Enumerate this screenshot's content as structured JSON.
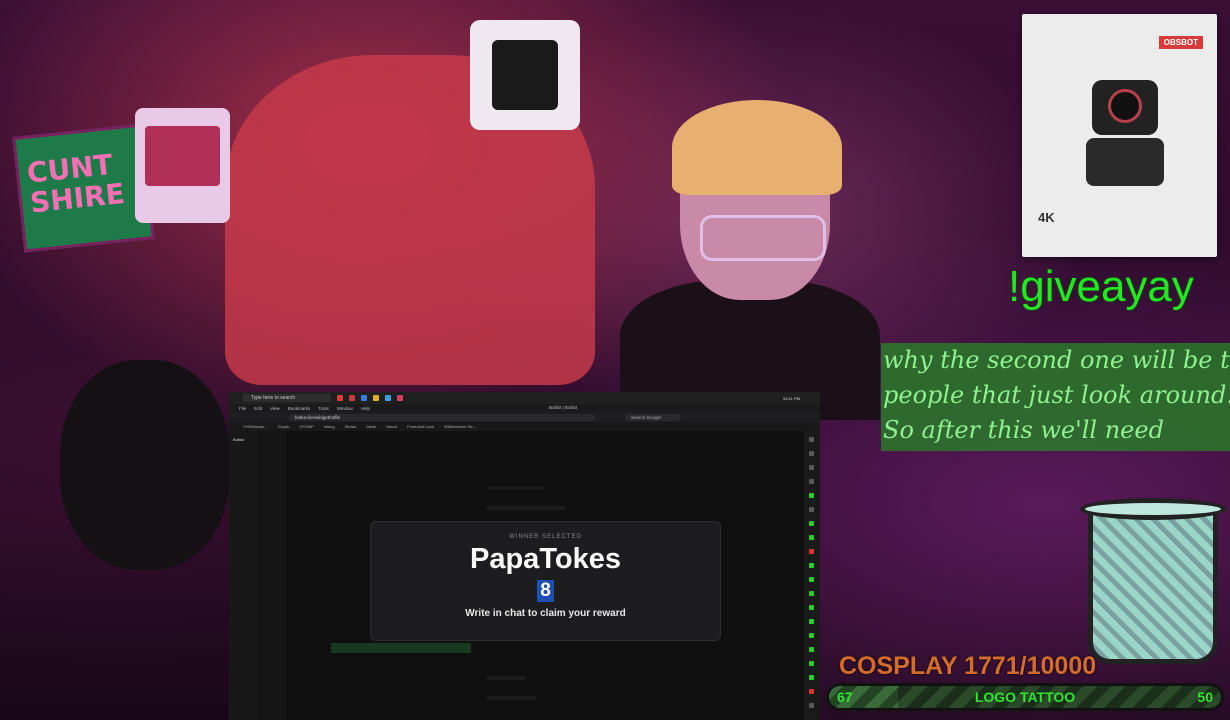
{
  "capture": {
    "taskbar": {
      "search_placeholder": "Type here to search",
      "clock": "10:41 PM"
    },
    "menubar": {
      "items": [
        "File",
        "Edit",
        "View",
        "Bookmarks",
        "Tools",
        "Window",
        "Help"
      ],
      "window_title": "Botlist | Botlist"
    },
    "addressbar": {
      "url": "botlist.live/widget/raffle",
      "search_placeholder": "Search Google"
    },
    "bookmarks": [
      "VHRitlander...",
      "Gxpak",
      "GPUMP",
      "Inking",
      "Strean",
      "Ideae",
      "Island",
      "Fearuded book",
      "Willowenium Ne..."
    ],
    "sidebar_tab": "Botlist",
    "winner": {
      "label": "WINNER SELECTED",
      "name": "PapaTokes",
      "count": "8",
      "instruction": "Write in chat to claim your reward"
    }
  },
  "product": {
    "brand": "OBSBOT",
    "spec": "4K"
  },
  "giveaway_command": "!giveayay",
  "captions": [
    "why the second one will be the",
    "people that just look around.",
    "So after this we'll need"
  ],
  "goal": {
    "title": "COSPLAY 1771/10000",
    "left": "67",
    "label": "LOGO TATTOO",
    "right": "50",
    "progress": 0.1771
  }
}
